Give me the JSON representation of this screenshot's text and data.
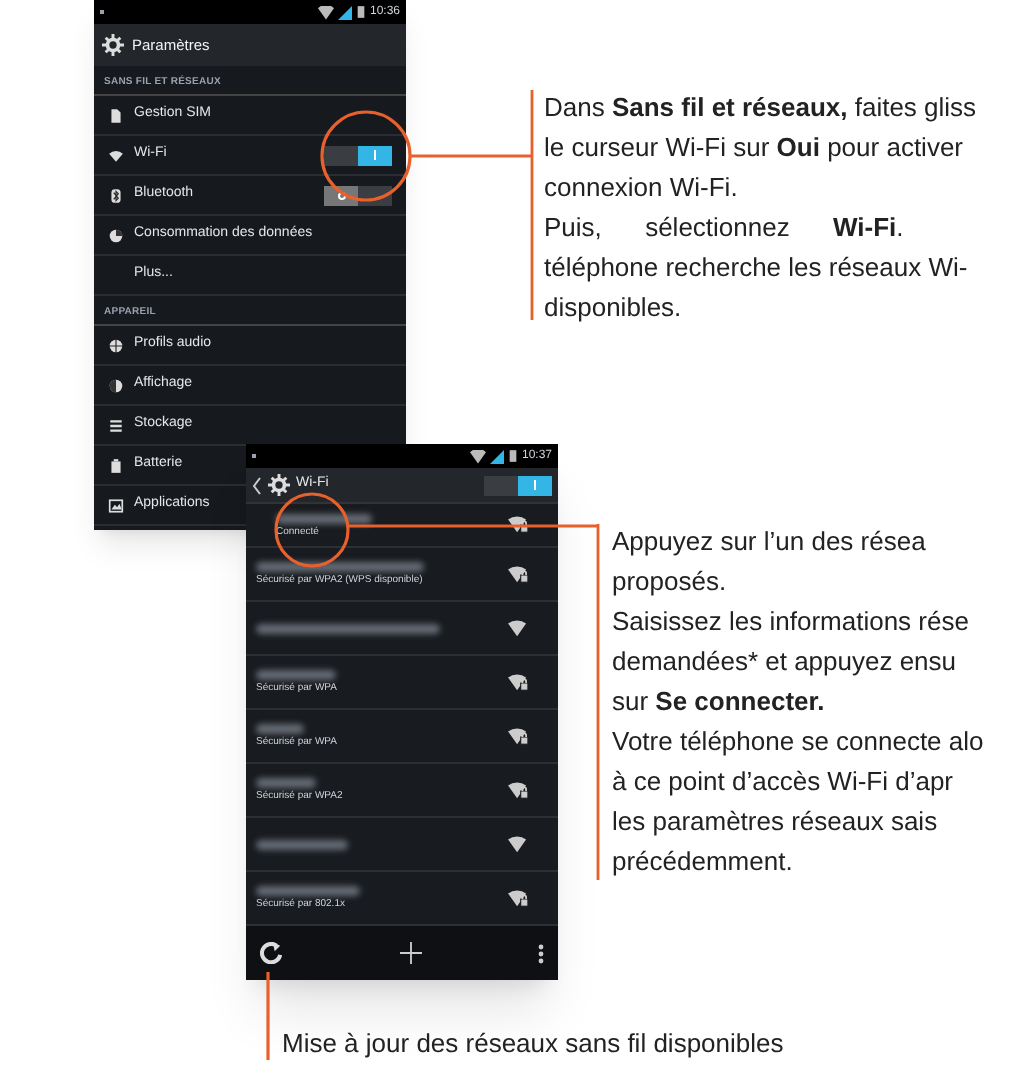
{
  "settings_screen": {
    "status_time": "10:36",
    "title": "Paramètres",
    "sections": [
      {
        "header": "SANS FIL ET RÉSEAUX",
        "items": [
          {
            "label": "Gestion SIM",
            "kind": "sim"
          },
          {
            "label": "Wi-Fi",
            "kind": "wifi",
            "on": true
          },
          {
            "label": "Bluetooth",
            "kind": "bluetooth",
            "on": false
          },
          {
            "label": "Consommation des données",
            "kind": "data"
          },
          {
            "label": "Plus...",
            "kind": "none"
          }
        ]
      },
      {
        "header": "APPAREIL",
        "items": [
          {
            "label": "Profils audio",
            "kind": "audio"
          },
          {
            "label": "Affichage",
            "kind": "display"
          },
          {
            "label": "Stockage",
            "kind": "storage"
          },
          {
            "label": "Batterie",
            "kind": "battery"
          },
          {
            "label": "Applications",
            "kind": "apps"
          }
        ]
      }
    ]
  },
  "wifi_screen": {
    "status_time": "10:37",
    "title": "Wi-Fi",
    "on": true,
    "networks": [
      {
        "detail": "Connecté",
        "locked": true
      },
      {
        "detail": "Sécurisé par WPA2 (WPS disponible)",
        "locked": true
      },
      {
        "locked": false
      },
      {
        "detail": "Sécurisé par WPA",
        "locked": true
      },
      {
        "detail": "Sécurisé par WPA",
        "locked": true
      },
      {
        "detail": "Sécurisé par WPA2",
        "locked": true
      },
      {
        "locked": false
      },
      {
        "detail": "Sécurisé par 802.1x",
        "locked": true
      }
    ]
  },
  "callouts": [
    {
      "lines": [
        "Dans **Sans fil et réseaux,** faites gliss",
        "le curseur Wi-Fi sur **Oui** pour activer",
        "connexion Wi-Fi.",
        "Puis,      sélectionnez      **Wi-Fi**.",
        "téléphone recherche les réseaux Wi-",
        "disponibles."
      ]
    },
    {
      "lines": [
        "Appuyez sur l’un des résea",
        "proposés.",
        "Saisissez les informations rése",
        "demandées* et appuyez ensu",
        "sur **Se connecter.**",
        "Votre téléphone se connecte alo",
        "à ce point d’accès Wi-Fi d’apr",
        "les paramètres réseaux sais",
        "précédemment."
      ]
    },
    {
      "lines": [
        "Mise à jour des réseaux sans fil disponibles"
      ]
    }
  ]
}
